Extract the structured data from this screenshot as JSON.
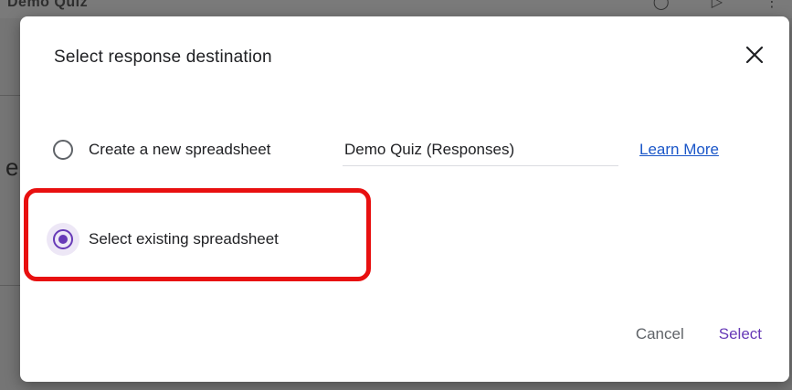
{
  "background": {
    "title_fragment": "Demo Quiz",
    "edge_letter": "e"
  },
  "dialog": {
    "title": "Select response destination",
    "close_icon": "close-icon",
    "options": {
      "new": {
        "label": "Create a new spreadsheet",
        "selected": false
      },
      "existing": {
        "label": "Select existing spreadsheet",
        "selected": true
      }
    },
    "spreadsheet_name": {
      "value": "Demo Quiz (Responses)"
    },
    "learn_more": "Learn More",
    "buttons": {
      "cancel": "Cancel",
      "select": "Select"
    }
  },
  "colors": {
    "accent": "#673ab7",
    "link": "#1a56c8",
    "highlight": "#e81010"
  }
}
